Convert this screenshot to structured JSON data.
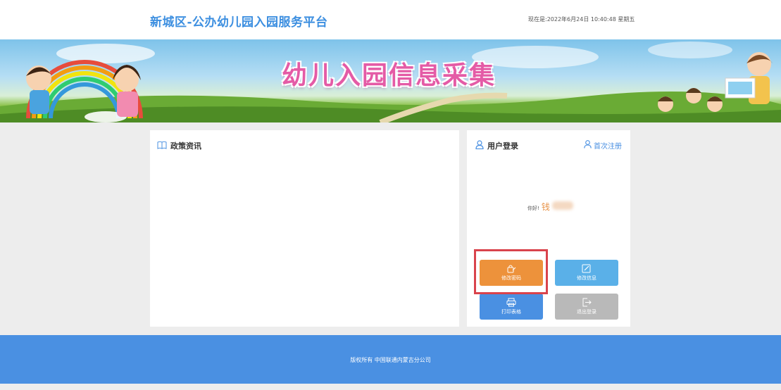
{
  "header": {
    "site_title": "新城区-公办幼儿园入园服务平台",
    "clock": "现在是:2022年6月24日 10:40:48 星期五"
  },
  "banner": {
    "title": "幼儿入园信息采集"
  },
  "news_panel": {
    "title": "政策资讯",
    "icon": "book-icon"
  },
  "login_panel": {
    "title": "用户登录",
    "register_link": "首次注册",
    "greeting_label": "你好!",
    "user_name": "钱",
    "buttons": {
      "change_password": "修改密码",
      "edit_info": "修改信息",
      "print_form": "打印表格",
      "logout": "退出登录"
    }
  },
  "footer": {
    "copyright": "版权所有 中国联通内蒙古分公司"
  },
  "colors": {
    "brand_blue": "#4a90e2",
    "orange": "#ed923b",
    "light_blue": "#5ab0e8",
    "gray": "#b9b9b9",
    "highlight_red": "#d9434c"
  }
}
